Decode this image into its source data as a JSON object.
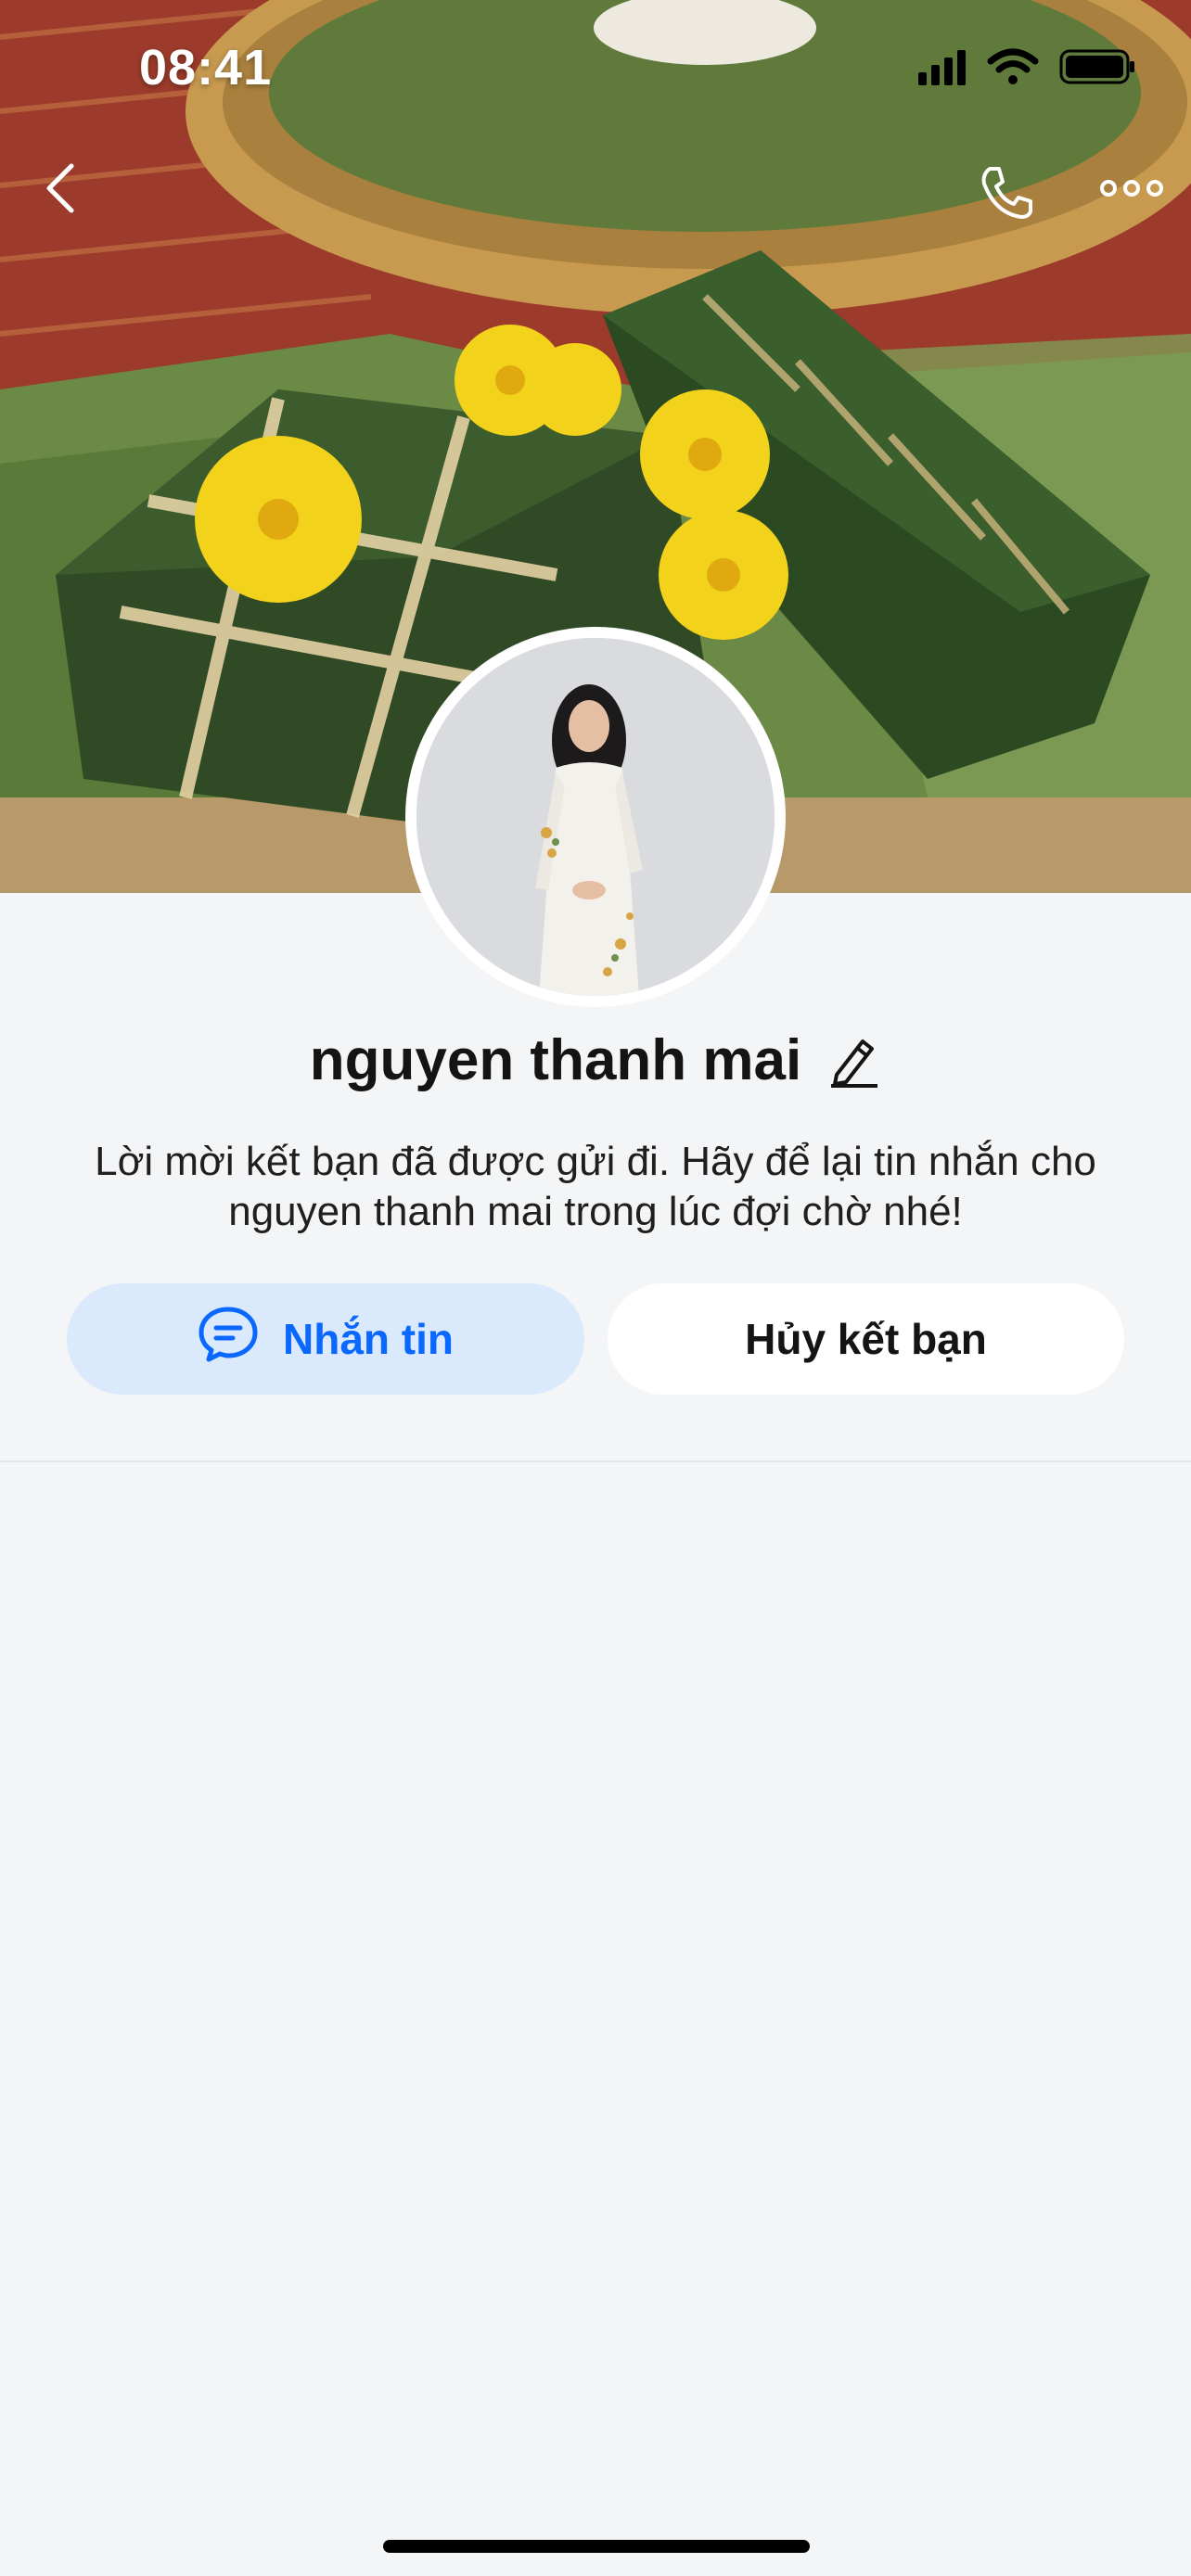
{
  "status_bar": {
    "time": "08:41",
    "icons": [
      "cellular-signal-icon",
      "wifi-icon",
      "battery-icon"
    ]
  },
  "nav": {
    "back_icon": "chevron-left-icon",
    "call_icon": "phone-icon",
    "more_icon": "more-horizontal-icon"
  },
  "profile": {
    "name": "nguyen thanh mai",
    "edit_icon": "pencil-icon",
    "status_message": "Lời mời kết bạn đã được gửi đi. Hãy để lại tin nhắn cho nguyen thanh mai trong lúc đợi chờ nhé!"
  },
  "actions": {
    "message_label": "Nhắn tin",
    "message_icon": "chat-bubble-icon",
    "unfriend_label": "Hủy kết bạn"
  },
  "colors": {
    "accent": "#0a68ff",
    "accent_bg": "#dbe9fd",
    "page_bg": "#f4f5f7"
  }
}
